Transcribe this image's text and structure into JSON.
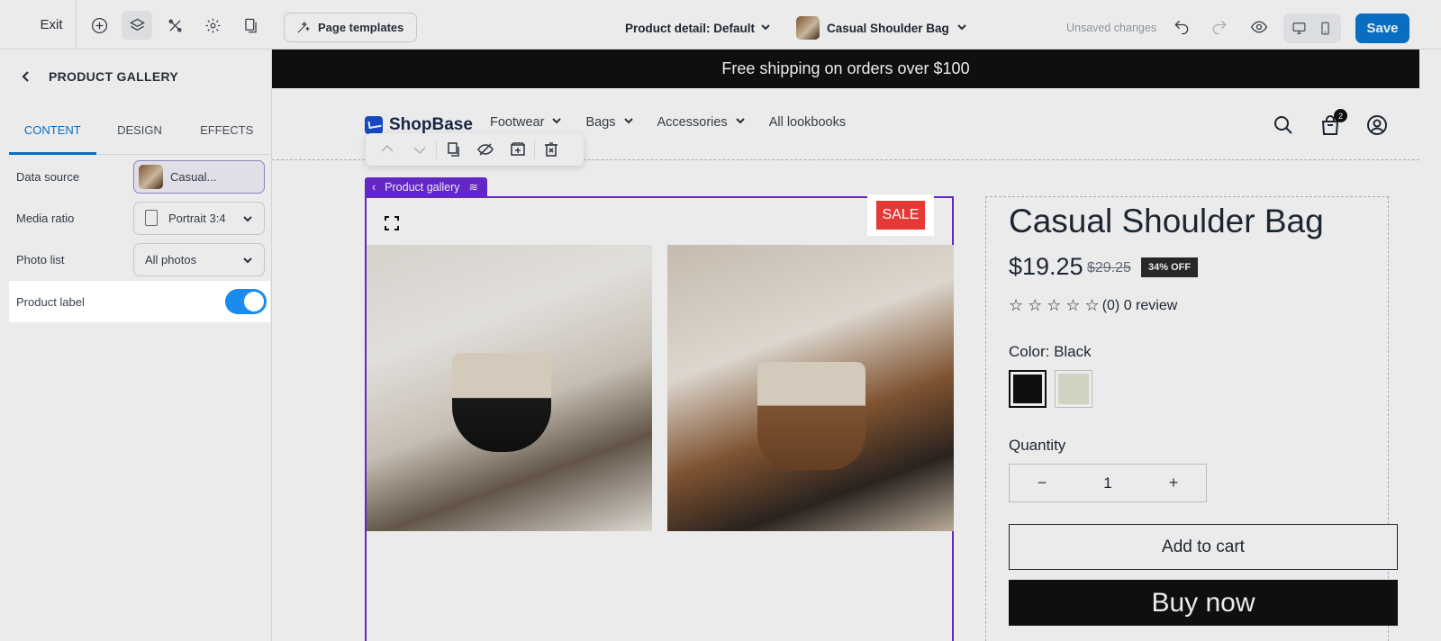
{
  "topbar": {
    "exit_label": "Exit",
    "page_templates_label": "Page templates",
    "page_selector": "Product detail: Default",
    "product_selector": "Casual Shoulder Bag",
    "unsaved_label": "Unsaved changes",
    "save_label": "Save"
  },
  "sidebar": {
    "title": "PRODUCT GALLERY",
    "tabs": [
      {
        "label": "CONTENT"
      },
      {
        "label": "DESIGN"
      },
      {
        "label": "EFFECTS"
      }
    ],
    "data_source": {
      "label": "Data source",
      "value": "Casual..."
    },
    "media_ratio": {
      "label": "Media ratio",
      "value": "Portrait 3:4"
    },
    "photo_list": {
      "label": "Photo list",
      "value": "All photos"
    },
    "product_label": {
      "label": "Product label",
      "enabled": true
    }
  },
  "store": {
    "announcement": "Free shipping on orders over $100",
    "logo_text": "ShopBase",
    "nav_links": [
      {
        "label": "Footwear"
      },
      {
        "label": "Bags"
      },
      {
        "label": "Accessories"
      },
      {
        "label": "All lookbooks"
      }
    ],
    "cart_count": "2",
    "gallery_tag": "Product gallery",
    "sale_label": "SALE",
    "product": {
      "title": "Casual Shoulder Bag",
      "price": "$19.25",
      "compare_price": "$29.25",
      "discount": "34% OFF",
      "stars": "☆ ☆ ☆ ☆ ☆",
      "reviews": "(0) 0 review",
      "color_label": "Color: Black",
      "quantity_label": "Quantity",
      "quantity_minus": "−",
      "quantity_value": "1",
      "quantity_plus": "+",
      "add_to_cart": "Add to cart",
      "buy_now": "Buy now"
    }
  },
  "colors": {
    "accent": "#0a78d2",
    "selection": "#6c2bd9",
    "sale": "#e53935",
    "swatch_black": "#111111",
    "swatch_cream": "#e4e4d4"
  }
}
